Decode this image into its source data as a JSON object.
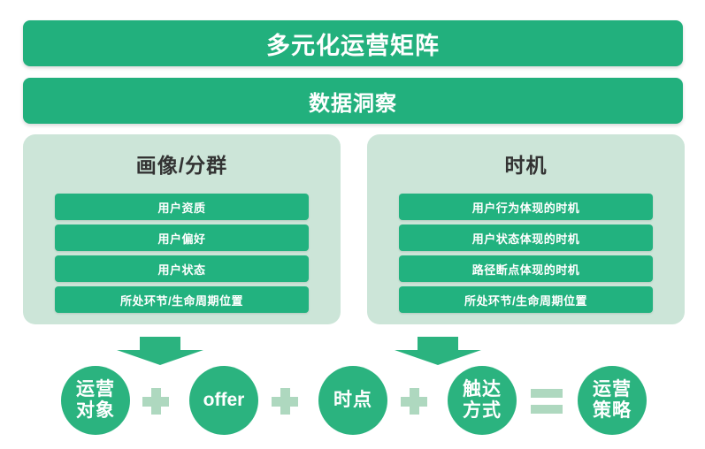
{
  "header": {
    "title": "多元化运营矩阵",
    "subtitle": "数据洞察"
  },
  "panels": [
    {
      "title": "画像/分群",
      "items": [
        "用户资质",
        "用户偏好",
        "用户状态",
        "所处环节/生命周期位置"
      ]
    },
    {
      "title": "时机",
      "items": [
        "用户行为体现的时机",
        "用户状态体现的时机",
        "路径断点体现的时机",
        "所处环节/生命周期位置"
      ]
    }
  ],
  "formula": {
    "nodes": [
      {
        "line1": "运营",
        "line2": "对象"
      },
      {
        "line1": "offer",
        "line2": ""
      },
      {
        "line1": "时点",
        "line2": ""
      },
      {
        "line1": "触达",
        "line2": "方式"
      },
      {
        "line1": "运营",
        "line2": "策略"
      }
    ],
    "operators": [
      "+",
      "+",
      "+",
      "="
    ]
  },
  "colors": {
    "banner_green": "#22b07d",
    "chip_green": "#22b27f",
    "panel_mint": "#cce5d8",
    "circle_green": "#2bb37f",
    "operator_green": "#aed8bf",
    "arrow_green": "#2bb37f",
    "text_dark": "#333333",
    "text_light": "#ffffff",
    "background": "#ffffff"
  }
}
